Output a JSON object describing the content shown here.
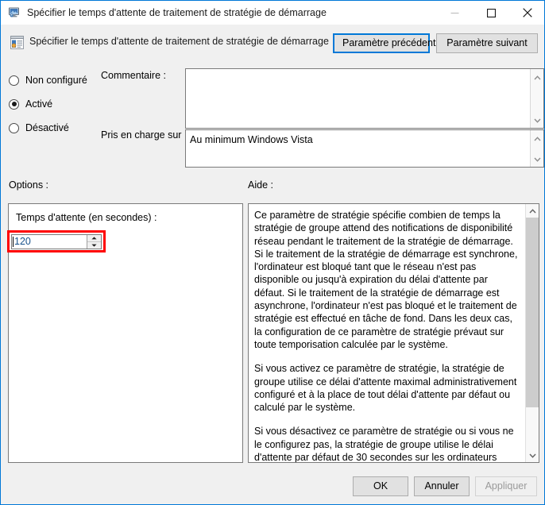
{
  "window": {
    "title": "Spécifier le temps d'attente de traitement de stratégie de démarrage",
    "icon": "computer-monitor-icon",
    "controls": {
      "minimize": "minimize-icon",
      "maximize": "maximize-icon",
      "close": "close-icon"
    },
    "accent_color": "#0078d7"
  },
  "header": {
    "policy_icon": "group-policy-setting-icon",
    "policy_name": "Spécifier le temps d'attente de traitement de stratégie de démarrage",
    "previous_button": "Paramètre précédent",
    "next_button": "Paramètre suivant"
  },
  "state": {
    "options": [
      {
        "label": "Non configuré",
        "selected": false
      },
      {
        "label": "Activé",
        "selected": true
      },
      {
        "label": "Désactivé",
        "selected": false
      }
    ]
  },
  "form": {
    "comment_label": "Commentaire :",
    "comment_value": "",
    "supported_label": "Pris en charge sur :",
    "supported_value": "Au minimum Windows Vista"
  },
  "sections": {
    "options_label": "Options :",
    "help_label": "Aide :"
  },
  "options_panel": {
    "field_label": "Temps d'attente (en secondes) :",
    "spinner_value": "120",
    "highlight_color": "#ff0000"
  },
  "help": {
    "paragraphs": [
      "Ce paramètre de stratégie spécifie combien de temps la stratégie de groupe attend des notifications de disponibilité réseau pendant le traitement de la stratégie de démarrage. Si le traitement de la stratégie de démarrage est synchrone, l'ordinateur est bloqué tant que le réseau n'est pas disponible ou jusqu'à expiration du délai d'attente par défaut. Si le traitement de la stratégie de démarrage est asynchrone, l'ordinateur n'est pas bloqué et le traitement de stratégie est effectué en tâche de fond. Dans les deux cas, la configuration de ce paramètre de stratégie prévaut sur toute temporisation calculée par le système.",
      "Si vous activez ce paramètre de stratégie, la stratégie de groupe utilise ce délai d'attente maximal administrativement configuré et à la place de tout délai d'attente par défaut ou calculé par le système.",
      "Si vous désactivez ce paramètre de stratégie ou si vous ne le configurez pas, la stratégie de groupe utilise le délai d'attente par défaut de 30 secondes sur les ordinateurs exécutant le système d'exploitation Windows Vista."
    ]
  },
  "footer": {
    "ok": "OK",
    "cancel": "Annuler",
    "apply": "Appliquer",
    "apply_disabled": true
  }
}
